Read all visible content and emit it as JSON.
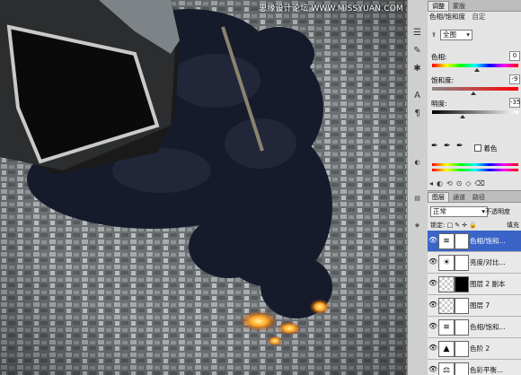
{
  "watermark": "思缘设计论坛 WWW.MISSYUAN.COM",
  "adjustments": {
    "tabs": [
      "调整",
      "蒙版"
    ],
    "panel_title": "色相/饱和度",
    "preset_tab": "自定",
    "range_select": "全图",
    "hue_label": "色相:",
    "hue_value": "0",
    "saturation_label": "饱和度:",
    "saturation_value": "-9",
    "lightness_label": "明度:",
    "lightness_value": "-35",
    "colorize_label": "着色"
  },
  "layers_panel": {
    "tabs": [
      "图层",
      "通道",
      "路径"
    ],
    "blend_mode": "正常",
    "opacity_label": "不透明度",
    "lock_label": "锁定:",
    "fill_label": "填充",
    "layers": [
      {
        "name": "色相/饱和...",
        "icon": "hue-saturation-icon",
        "mask": "white",
        "active": true
      },
      {
        "name": "亮度/对比...",
        "icon": "brightness-contrast-icon",
        "mask": "white",
        "active": false
      },
      {
        "name": "图层 2 副本",
        "icon": "layer-thumb",
        "mask": "black",
        "active": false
      },
      {
        "name": "图层 7",
        "icon": "layer-thumb",
        "mask": "white",
        "active": false
      },
      {
        "name": "色相/饱和...",
        "icon": "hue-saturation-icon",
        "mask": "white",
        "active": false
      },
      {
        "name": "色阶 2",
        "icon": "levels-icon",
        "mask": "white",
        "active": false
      },
      {
        "name": "色彩平衡...",
        "icon": "color-balance-icon",
        "mask": "white",
        "active": false
      }
    ]
  },
  "colors": {
    "selection_blue": "#3a64c8",
    "smoke": "#161b2c",
    "fire": "#ff8c1a"
  }
}
